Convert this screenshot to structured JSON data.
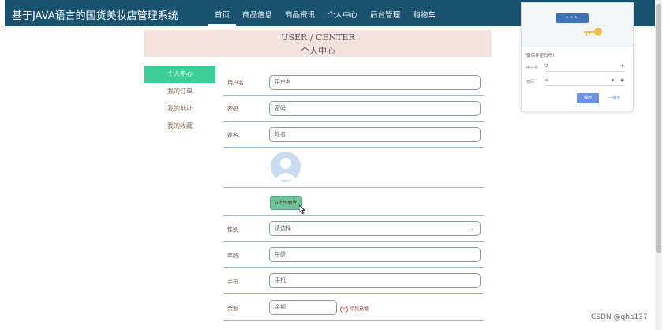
{
  "header": {
    "site_title": "基于JAVA语言的国货美妆店管理系统",
    "nav": [
      "首页",
      "商品信息",
      "商品资讯",
      "个人中心",
      "后台管理",
      "购物车"
    ]
  },
  "page_header": {
    "title_en": "USER / CENTER",
    "title_cn": "个人中心"
  },
  "sidebar": {
    "items": [
      "个人中心",
      "我的订单",
      "我的地址",
      "我的收藏"
    ]
  },
  "form": {
    "username_label": "用户名",
    "username_placeholder": "用户名",
    "password_label": "密码",
    "password_placeholder": "密码",
    "name_label": "姓名",
    "name_placeholder": "姓名",
    "upload_label": "上传图片",
    "gender_label": "性别",
    "gender_value": "请选择",
    "age_label": "年龄",
    "age_placeholder": "年龄",
    "phone_label": "手机",
    "phone_placeholder": "手机",
    "balance_label": "余额",
    "balance_placeholder": "余额",
    "recharge_label": "点我充值"
  },
  "password_popup": {
    "masked_password": "***",
    "title": "要保存密码吗?",
    "username_label": "用户名",
    "username_value": "2",
    "password_label": "密码",
    "password_value": "•",
    "save_label": "保存",
    "never_label": "一律不"
  },
  "watermark": "CSDN @qha137",
  "colors": {
    "topbar": "#18526e",
    "sidebar_active": "#3dcf9a",
    "upload": "#6fc49b"
  }
}
